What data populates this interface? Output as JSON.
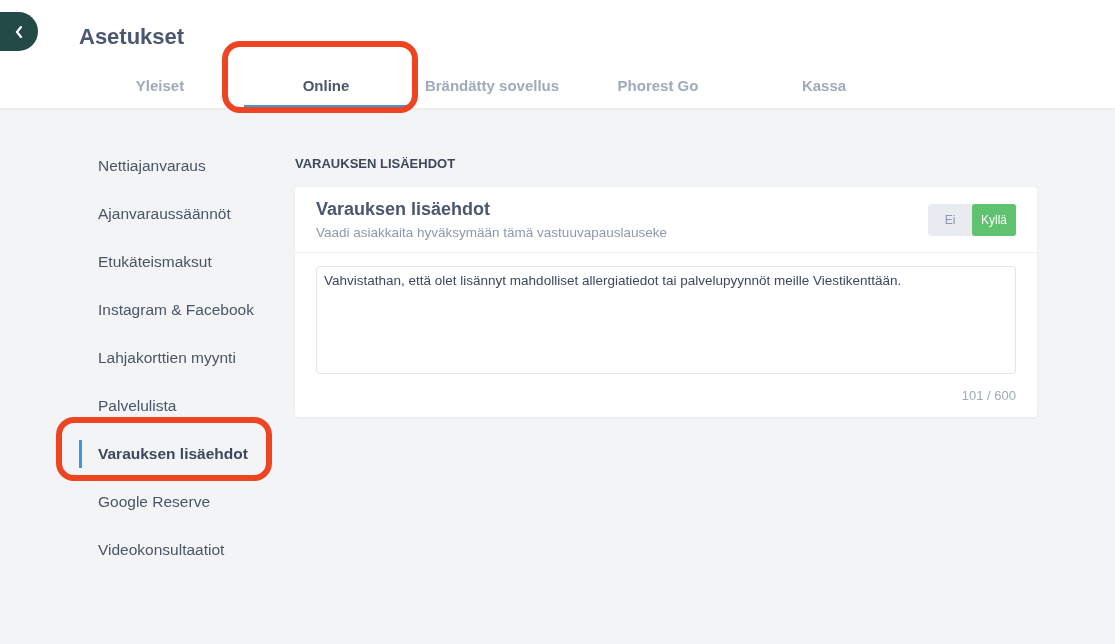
{
  "header": {
    "title": "Asetukset"
  },
  "tabs": [
    {
      "label": "Yleiset",
      "selected": false,
      "highlighted": false
    },
    {
      "label": "Online",
      "selected": true,
      "highlighted": true
    },
    {
      "label": "Brändätty sovellus",
      "selected": false,
      "highlighted": false
    },
    {
      "label": "Phorest Go",
      "selected": false,
      "highlighted": false
    },
    {
      "label": "Kassa",
      "selected": false,
      "highlighted": false
    }
  ],
  "sidebar": {
    "items": [
      {
        "label": "Nettiajanvaraus",
        "selected": false,
        "highlighted": false
      },
      {
        "label": "Ajanvaraussäännöt",
        "selected": false,
        "highlighted": false
      },
      {
        "label": "Etukäteismaksut",
        "selected": false,
        "highlighted": false
      },
      {
        "label": "Instagram & Facebook",
        "selected": false,
        "highlighted": false
      },
      {
        "label": "Lahjakorttien myynti",
        "selected": false,
        "highlighted": false
      },
      {
        "label": "Palvelulista",
        "selected": false,
        "highlighted": false
      },
      {
        "label": "Varauksen lisäehdot",
        "selected": true,
        "highlighted": true
      },
      {
        "label": "Google Reserve",
        "selected": false,
        "highlighted": false
      },
      {
        "label": "Videokonsultaatiot",
        "selected": false,
        "highlighted": false
      }
    ]
  },
  "section": {
    "heading": "VARAUKSEN LISÄEHDOT",
    "card": {
      "title": "Varauksen lisäehdot",
      "subtitle": "Vaadi asiakkaita hyväksymään tämä vastuuvapauslauseke",
      "toggle": [
        {
          "label": "Ei",
          "selected": false
        },
        {
          "label": "Kyllä",
          "selected": true
        }
      ],
      "textarea": {
        "value": "Vahvistathan, että olet lisännyt mahdolliset allergiatiedot tai palvelupyynnöt meille Viestikenttään."
      },
      "counter": "101 / 600"
    }
  }
}
